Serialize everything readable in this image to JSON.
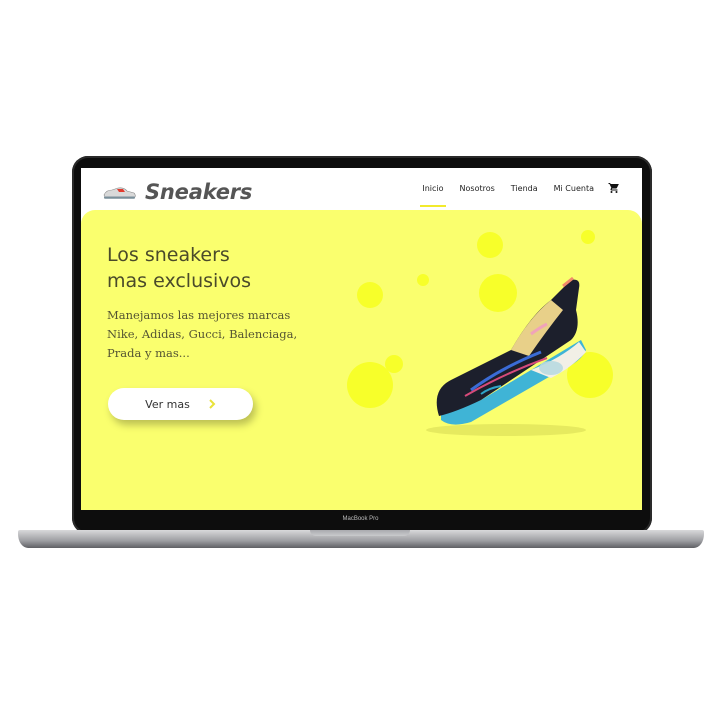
{
  "laptop": {
    "model_label": "MacBook Pro"
  },
  "site": {
    "logo_text": "Sneakers",
    "nav": {
      "items": [
        {
          "label": "Inicio",
          "active": true
        },
        {
          "label": "Nosotros",
          "active": false
        },
        {
          "label": "Tienda",
          "active": false
        },
        {
          "label": "Mi Cuenta",
          "active": false
        }
      ],
      "cart_icon": "shopping-cart-icon"
    },
    "hero": {
      "title_line1": "Los sneakers",
      "title_line2": "mas exclusivos",
      "subtitle_line1": "Manejamos las mejores marcas",
      "subtitle_line2": "Nike, Adidas, Gucci, Balenciaga,",
      "subtitle_line3": "Prada y mas...",
      "button_label": "Ver mas",
      "button_icon": "chevron-right-icon"
    }
  },
  "colors": {
    "hero_bg": "#faff6e",
    "bubble": "#f7ff2a",
    "accent_underline": "#f2ea2c"
  }
}
